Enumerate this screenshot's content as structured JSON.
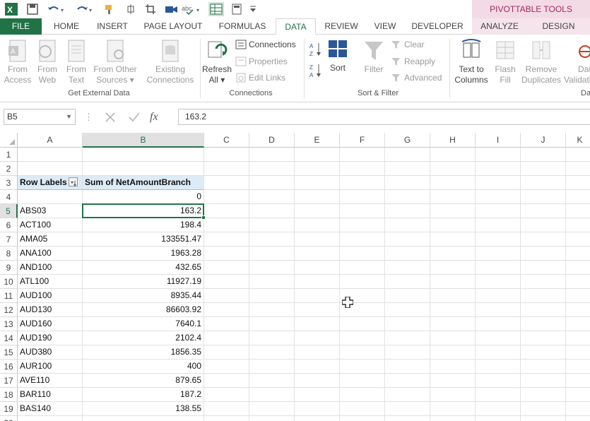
{
  "title_bar": {
    "pivot_tools_label": "PIVOTTABLE TOOLS",
    "accent_color": "#217346",
    "context_color": "#a6285e"
  },
  "tabs": [
    {
      "label": "FILE"
    },
    {
      "label": "HOME"
    },
    {
      "label": "INSERT"
    },
    {
      "label": "PAGE LAYOUT"
    },
    {
      "label": "FORMULAS"
    },
    {
      "label": "DATA"
    },
    {
      "label": "REVIEW"
    },
    {
      "label": "VIEW"
    },
    {
      "label": "DEVELOPER"
    },
    {
      "label": "ANALYZE"
    },
    {
      "label": "DESIGN"
    }
  ],
  "ribbon": {
    "get_external": {
      "from_access": [
        "From",
        "Access"
      ],
      "from_web": [
        "From",
        "Web"
      ],
      "from_text": [
        "From",
        "Text"
      ],
      "from_other": [
        "From Other",
        "Sources ▾"
      ],
      "existing": [
        "Existing",
        "Connections"
      ],
      "label": "Get External Data"
    },
    "connections": {
      "refresh": [
        "Refresh",
        "All ▾"
      ],
      "connections": "Connections",
      "properties": "Properties",
      "edit_links": "Edit Links",
      "label": "Connections"
    },
    "sort_filter": {
      "sort": "Sort",
      "filter": "Filter",
      "clear": "Clear",
      "reapply": "Reapply",
      "advanced": "Advanced",
      "label": "Sort & Filter"
    },
    "data_tools": {
      "text_to_columns": [
        "Text to",
        "Columns"
      ],
      "flash_fill": [
        "Flash",
        "Fill"
      ],
      "remove_duplicates": [
        "Remove",
        "Duplicates"
      ],
      "data_validation": [
        "Data",
        "Validati"
      ],
      "label": "Da"
    }
  },
  "formula_bar": {
    "name_box": "B5",
    "fx": "fx",
    "formula": "163.2"
  },
  "columns": [
    "A",
    "B",
    "C",
    "D",
    "E",
    "F",
    "G",
    "H",
    "I",
    "J",
    "K"
  ],
  "rows": [
    "1",
    "2",
    "3",
    "4",
    "5",
    "6",
    "7",
    "8",
    "9",
    "10",
    "11",
    "12",
    "13",
    "14",
    "15",
    "16",
    "17",
    "18",
    "19",
    "20"
  ],
  "pivot": {
    "header_row_labels": "Row Labels",
    "header_value": "Sum of NetAmountBranch",
    "rows": [
      {
        "label": "",
        "value": "0"
      },
      {
        "label": "ABS03",
        "value": "163.2"
      },
      {
        "label": "ACT100",
        "value": "198.4"
      },
      {
        "label": "AMA05",
        "value": "133551.47"
      },
      {
        "label": "ANA100",
        "value": "1963.28"
      },
      {
        "label": "AND100",
        "value": "432.65"
      },
      {
        "label": "ATL100",
        "value": "11927.19"
      },
      {
        "label": "AUD100",
        "value": "8935.44"
      },
      {
        "label": "AUD130",
        "value": "86603.92"
      },
      {
        "label": "AUD160",
        "value": "7640.1"
      },
      {
        "label": "AUD190",
        "value": "2102.4"
      },
      {
        "label": "AUD380",
        "value": "1856.35"
      },
      {
        "label": "AUR100",
        "value": "400"
      },
      {
        "label": "AVE110",
        "value": "879.65"
      },
      {
        "label": "BAR110",
        "value": "187.2"
      },
      {
        "label": "BAS140",
        "value": "138.55"
      }
    ]
  }
}
